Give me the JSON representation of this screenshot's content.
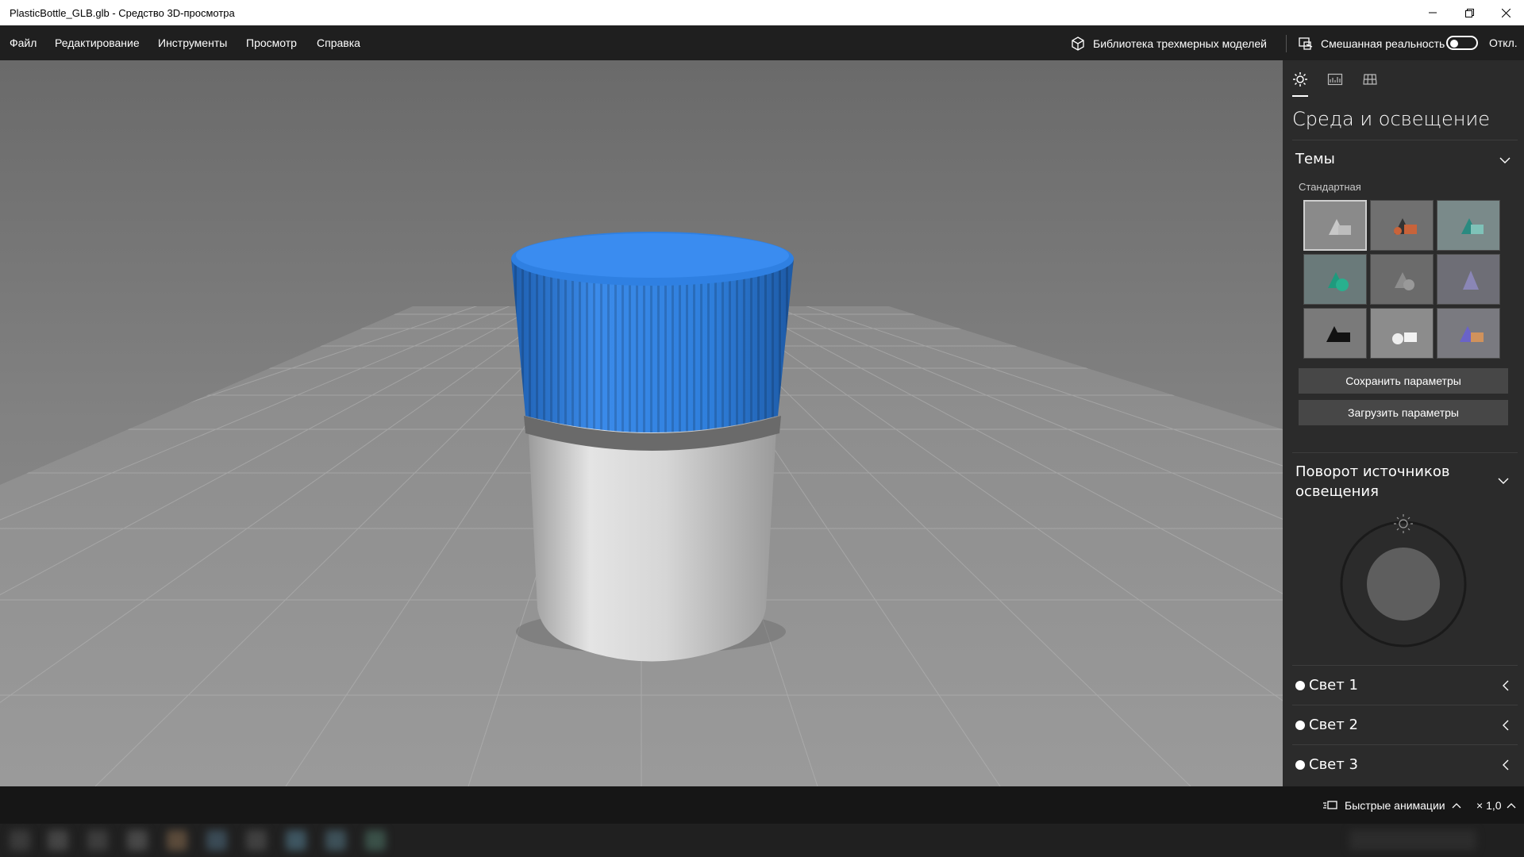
{
  "window": {
    "title": "PlasticBottle_GLB.glb - Средство 3D-просмотра"
  },
  "menu": {
    "items": [
      "Файл",
      "Редактирование",
      "Инструменты",
      "Просмотр",
      "Справка"
    ],
    "library_label": "Библиотека трехмерных моделей",
    "mixed_reality_label": "Смешанная реальность",
    "mixed_reality_state": "Откл."
  },
  "panel": {
    "title": "Среда и освещение",
    "themes": {
      "title": "Темы",
      "group_label": "Стандартная",
      "save_label": "Сохранить параметры",
      "load_label": "Загрузить параметры"
    },
    "rotation": {
      "title_line1": "Поворот источников",
      "title_line2": "освещения"
    },
    "lights": [
      "Свет 1",
      "Свет 2",
      "Свет 3"
    ]
  },
  "status": {
    "animations_label": "Быстрые анимации",
    "speed_label": "× 1,0"
  },
  "colors": {
    "cap_blue": "#2f7fdc",
    "accent_white": "#ffffff",
    "panel_bg": "#2b2b2b"
  }
}
